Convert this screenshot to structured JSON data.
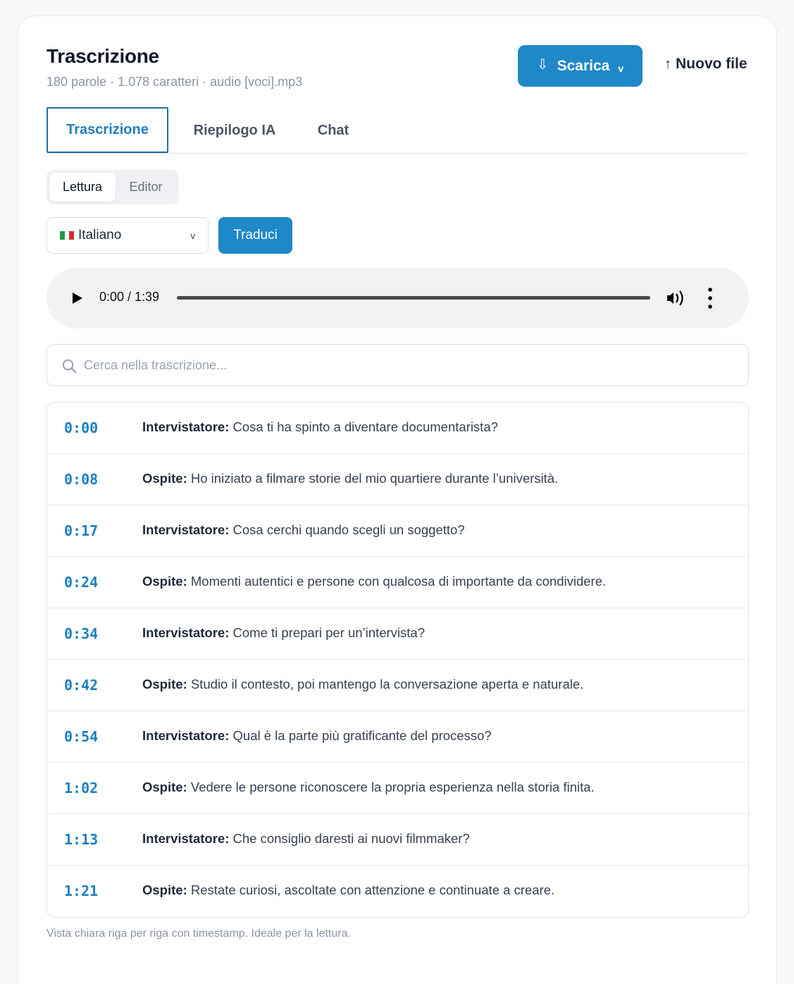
{
  "header": {
    "title": "Trascrizione",
    "meta": "180 parole · 1.078 caratteri · audio [voci].mp3",
    "download_label": "Scarica",
    "new_file_label": "Nuovo file"
  },
  "tabs": [
    {
      "label": "Trascrizione",
      "active": true
    },
    {
      "label": "Riepilogo IA",
      "active": false
    },
    {
      "label": "Chat",
      "active": false
    }
  ],
  "view_mode": {
    "options": [
      "Lettura",
      "Editor"
    ],
    "selected": "Lettura"
  },
  "language": {
    "selected": "Italiano",
    "translate_label": "Traduci"
  },
  "player": {
    "time": "0:00 / 1:39",
    "progress": 0
  },
  "search": {
    "placeholder": "Cerca nella trascrizione...",
    "value": ""
  },
  "transcript": [
    {
      "time": "0:00",
      "speaker": "Intervistatore:",
      "text": "Cosa ti ha spinto a diventare documentarista?"
    },
    {
      "time": "0:08",
      "speaker": "Ospite:",
      "text": "Ho iniziato a filmare storie del mio quartiere durante l’università."
    },
    {
      "time": "0:17",
      "speaker": "Intervistatore:",
      "text": "Cosa cerchi quando scegli un soggetto?"
    },
    {
      "time": "0:24",
      "speaker": "Ospite:",
      "text": "Momenti autentici e persone con qualcosa di importante da condividere."
    },
    {
      "time": "0:34",
      "speaker": "Intervistatore:",
      "text": "Come ti prepari per un’intervista?"
    },
    {
      "time": "0:42",
      "speaker": "Ospite:",
      "text": "Studio il contesto, poi mantengo la conversazione aperta e naturale."
    },
    {
      "time": "0:54",
      "speaker": "Intervistatore:",
      "text": "Qual è la parte più gratificante del processo?"
    },
    {
      "time": "1:02",
      "speaker": "Ospite:",
      "text": "Vedere le persone riconoscere la propria esperienza nella storia finita."
    },
    {
      "time": "1:13",
      "speaker": "Intervistatore:",
      "text": "Che consiglio daresti ai nuovi filmmaker?"
    },
    {
      "time": "1:21",
      "speaker": "Ospite:",
      "text": "Restate curiosi, ascoltate con attenzione e continuate a creare."
    }
  ],
  "footer_note": "Vista chiara riga per riga con timestamp. Ideale per la lettura.",
  "colors": {
    "accent": "#1e88c8",
    "timestamp": "#1e7fbf",
    "muted": "#8a94a6"
  },
  "icons": [
    "download-icon",
    "chevron-down-icon",
    "arrow-up-icon",
    "italy-flag-icon",
    "play-icon",
    "volume-icon",
    "more-vertical-icon",
    "search-icon"
  ]
}
